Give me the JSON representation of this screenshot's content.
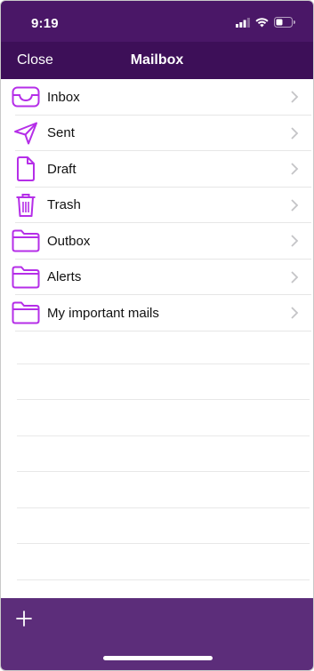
{
  "status_bar": {
    "time": "9:19"
  },
  "nav": {
    "close_label": "Close",
    "title": "Mailbox"
  },
  "folders": [
    {
      "label": "Inbox",
      "icon": "inbox-icon"
    },
    {
      "label": "Sent",
      "icon": "sent-icon"
    },
    {
      "label": "Draft",
      "icon": "draft-icon"
    },
    {
      "label": "Trash",
      "icon": "trash-icon"
    },
    {
      "label": "Outbox",
      "icon": "folder-icon"
    },
    {
      "label": "Alerts",
      "icon": "folder-icon"
    },
    {
      "label": "My important mails",
      "icon": "folder-icon"
    }
  ],
  "colors": {
    "status_bar": "#4a1767",
    "nav_bar": "#3d0f58",
    "bottom_bar": "#5c2d7a",
    "icon_accent": "#b52ee8"
  }
}
